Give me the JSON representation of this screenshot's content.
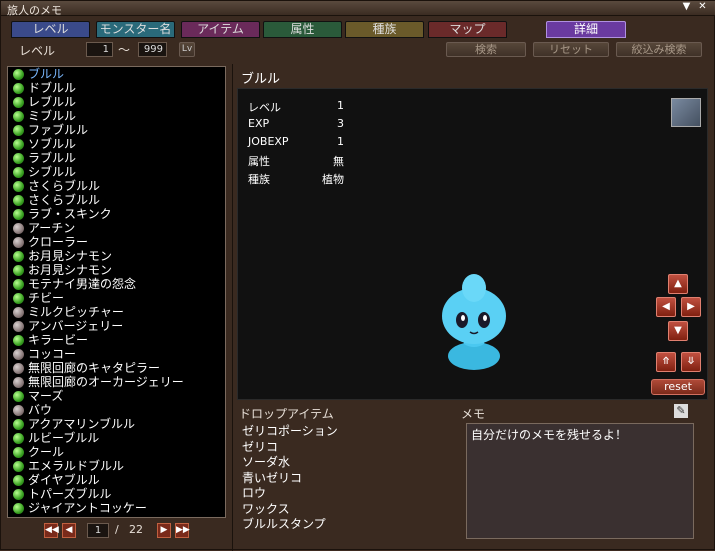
{
  "window": {
    "title": "旅人のメモ",
    "minimize_label": "▼",
    "close_label": "✕"
  },
  "tabs": [
    {
      "label": "レベル",
      "bg": "#3a4a8a"
    },
    {
      "label": "モンスター名",
      "bg": "#2a6a7a"
    },
    {
      "label": "アイテム",
      "bg": "#6a2a5a"
    },
    {
      "label": "属性",
      "bg": "#2a5a3a"
    },
    {
      "label": "種族",
      "bg": "#6a5a2a"
    },
    {
      "label": "マップ",
      "bg": "#6a2a2a"
    }
  ],
  "detail_tab": {
    "label": "詳細"
  },
  "filter": {
    "level_label": "レベル",
    "min": "1",
    "tilde": "〜",
    "max": "999",
    "lv_label": "Lv",
    "search_label": "検索",
    "reset_label": "リセット",
    "refine_label": "絞込み検索"
  },
  "monsters": [
    {
      "name": "ブルル",
      "status": "g",
      "selected": true
    },
    {
      "name": "ドブルル",
      "status": "g"
    },
    {
      "name": "レブルル",
      "status": "g"
    },
    {
      "name": "ミブルル",
      "status": "g"
    },
    {
      "name": "ファブルル",
      "status": "g"
    },
    {
      "name": "ソブルル",
      "status": "g"
    },
    {
      "name": "ラブルル",
      "status": "g"
    },
    {
      "name": "シブルル",
      "status": "g"
    },
    {
      "name": "さくらブルル",
      "status": "g"
    },
    {
      "name": "さくらブルル",
      "status": "g"
    },
    {
      "name": "ラブ・スキンク",
      "status": "g"
    },
    {
      "name": "アーチン",
      "status": "x"
    },
    {
      "name": "クローラー",
      "status": "x"
    },
    {
      "name": "お月見シナモン",
      "status": "g"
    },
    {
      "name": "お月見シナモン",
      "status": "g"
    },
    {
      "name": "モテナイ男達の怨念",
      "status": "g"
    },
    {
      "name": "チビー",
      "status": "g"
    },
    {
      "name": "ミルクピッチャー",
      "status": "x"
    },
    {
      "name": "アンバージェリー",
      "status": "x"
    },
    {
      "name": "キラービー",
      "status": "g"
    },
    {
      "name": "コッコー",
      "status": "x"
    },
    {
      "name": "無限回廊のキャタピラー",
      "status": "x"
    },
    {
      "name": "無限回廊のオーカージェリー",
      "status": "x"
    },
    {
      "name": "マーズ",
      "status": "g"
    },
    {
      "name": "バウ",
      "status": "x"
    },
    {
      "name": "アクアマリンブルル",
      "status": "g"
    },
    {
      "name": "ルビーブルル",
      "status": "g"
    },
    {
      "name": "クール",
      "status": "g"
    },
    {
      "name": "エメラルドブルル",
      "status": "g"
    },
    {
      "name": "ダイヤブルル",
      "status": "g"
    },
    {
      "name": "トパーズブルル",
      "status": "g"
    },
    {
      "name": "ジャイアントコッケー",
      "status": "g"
    }
  ],
  "pager": {
    "current": "1",
    "sep": "/",
    "total": "22",
    "first": "◀◀",
    "prev": "◀",
    "next": "▶",
    "last": "▶▶"
  },
  "detail": {
    "name": "ブルル",
    "stats": [
      {
        "label": "レベル",
        "value": "1"
      },
      {
        "label": "EXP",
        "value": "3"
      },
      {
        "label": "JOBEXP",
        "value": "1"
      },
      {
        "label": "属性",
        "value": "無"
      },
      {
        "label": "種族",
        "value": "植物"
      }
    ],
    "arrows": {
      "up": "▲",
      "left": "◀",
      "right": "▶",
      "down": "▼",
      "rot_up": "⤊",
      "rot_down": "⤋"
    },
    "reset_label": "reset"
  },
  "drops": {
    "title": "ドロップアイテム",
    "items": [
      "ゼリコポーション",
      "ゼリコ",
      "ソーダ水",
      "青いゼリコ",
      "ロウ",
      "ワックス",
      "ブルルスタンプ"
    ]
  },
  "memo": {
    "title": "メモ",
    "text": "自分だけのメモを残せるよ！",
    "edit_icon": "✎"
  }
}
